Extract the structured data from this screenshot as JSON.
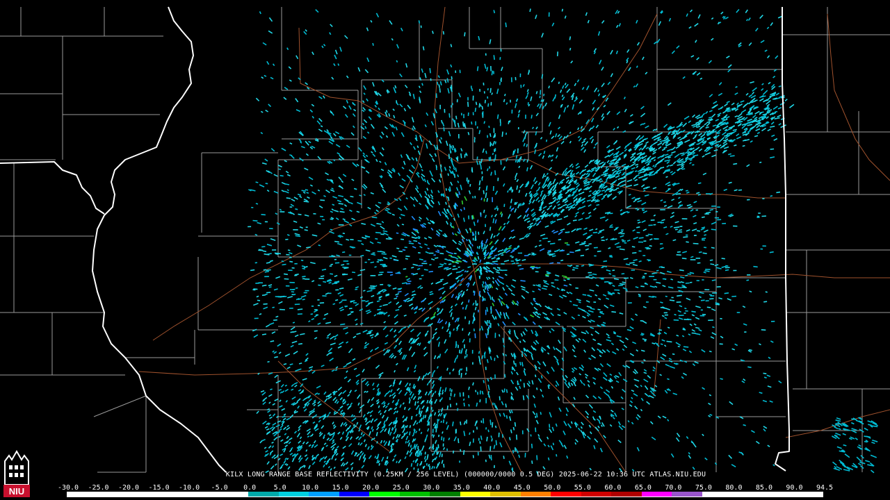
{
  "caption": "KILX LONG RANGE BASE REFLECTIVITY (0.25KM / 256 LEVEL) (000000/0000 0.5 DEG) 2025-06-22 10:36 UTC  ATLAS.NIU.EDU",
  "legend": {
    "ticks": [
      "-30.0",
      "-25.0",
      "-20.0",
      "-15.0",
      "-10.0",
      "-5.0",
      "0.0",
      "5.0",
      "10.0",
      "15.0",
      "20.0",
      "25.0",
      "30.0",
      "35.0",
      "40.0",
      "45.0",
      "50.0",
      "55.0",
      "60.0",
      "65.0",
      "70.0",
      "75.0",
      "80.0",
      "85.0",
      "90.0",
      "94.5"
    ],
    "colors": [
      "#ffffff",
      "#ffffff",
      "#ffffff",
      "#ffffff",
      "#ffffff",
      "#ffffff",
      "#00aaaa",
      "#00d0e0",
      "#00a0ff",
      "#0000ff",
      "#00ff00",
      "#00c000",
      "#008000",
      "#ffff00",
      "#e0c000",
      "#ff8000",
      "#ff0000",
      "#d00000",
      "#b00000",
      "#ff00ff",
      "#9955cc",
      "#ffffff",
      "#ffffff",
      "#ffffff",
      "#ffffff"
    ]
  },
  "logo": {
    "text": "NIU",
    "colors": {
      "red": "#c8102e",
      "white": "#ffffff"
    }
  },
  "map": {
    "state_border_color": "#ffffff",
    "county_border_color": "#9a9a9a",
    "road_color": "#a0522d",
    "echo_colors": [
      "#20d8e8",
      "#00bcd4",
      "#1e90ff",
      "#2e8b57",
      "#32cd32"
    ]
  }
}
